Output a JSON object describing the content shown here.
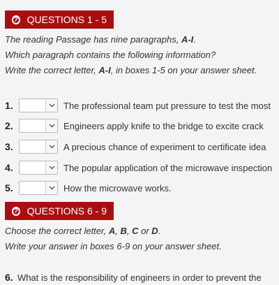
{
  "section1": {
    "title": "QUESTIONS 1 - 5",
    "instructions": {
      "line1_pre": "The reading Passage has nine paragraphs, ",
      "line1_bold": "A-I",
      "line1_post": ".",
      "line2": "Which paragraph contains the following information?",
      "line3_pre": "Write the correct letter, ",
      "line3_bold": "A-I",
      "line3_post": ", in boxes 1-5 on your answer sheet."
    },
    "questions": [
      {
        "num": "1.",
        "text": "The professional team put pressure to test the most"
      },
      {
        "num": "2.",
        "text": "Engineers apply knife to the bridge to excite crack"
      },
      {
        "num": "3.",
        "text": "A precious chance of experiment to certificate idea"
      },
      {
        "num": "4.",
        "text": "The popular application of the microwave inspection"
      },
      {
        "num": "5.",
        "text": "How the microwave works."
      }
    ]
  },
  "section2": {
    "title": "QUESTIONS 6 - 9",
    "instructions": {
      "line1_pre": "Choose the correct letter, ",
      "letter_a": "A",
      "sep1": ", ",
      "letter_b": "B",
      "sep2": ", ",
      "letter_c": "C",
      "or": " or ",
      "letter_d": "D",
      "line1_post": ".",
      "line2": "Write your answer in boxes 6-9 on your answer sheet."
    },
    "question6": {
      "num": "6.",
      "text": "What is the responsibility of engineers in order to prevent the"
    }
  },
  "colors": {
    "header_bg": "#a90f12",
    "page_bg": "#f4f4f4"
  },
  "icons": {
    "header": "question-circle-icon",
    "dropdown": "chevron-down-icon"
  }
}
